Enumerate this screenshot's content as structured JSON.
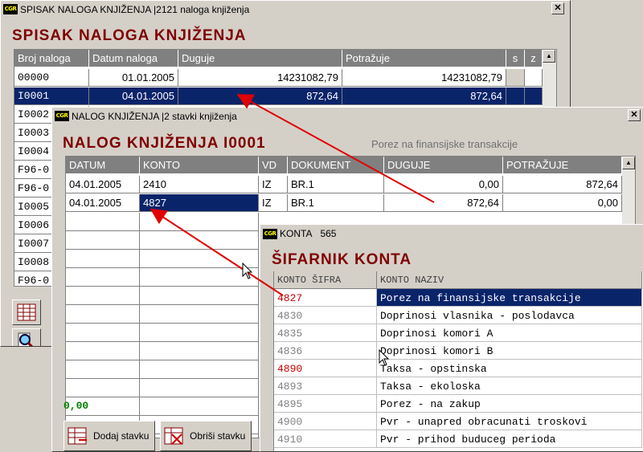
{
  "win1": {
    "title": "SPISAK NALOGA KNJIŽENJA |2121 naloga knjiženja",
    "heading": "SPISAK NALOGA KNJIŽENJA",
    "columns": [
      "Broj naloga",
      "Datum naloga",
      "Duguje",
      "Potražuje",
      "s",
      "z"
    ],
    "rows": [
      {
        "broj": "00000",
        "datum": "01.01.2005",
        "duguje": "14231082,79",
        "potrazuje": "14231082,79"
      },
      {
        "broj": "I0001",
        "datum": "04.01.2005",
        "duguje": "872,64",
        "potrazuje": "872,64"
      },
      {
        "broj": "I0002"
      },
      {
        "broj": "I0003"
      },
      {
        "broj": "I0004"
      },
      {
        "broj": "F96-0"
      },
      {
        "broj": "F96-0"
      },
      {
        "broj": "I0005"
      },
      {
        "broj": "I0006"
      },
      {
        "broj": "I0007"
      },
      {
        "broj": "I0008"
      },
      {
        "broj": "F96-0"
      }
    ]
  },
  "win2": {
    "title": "NALOG KNJIŽENJA |2 stavki knjiženja",
    "heading": "NALOG KNJIŽENJA I0001",
    "subtitle": "Porez na finansijske transakcije",
    "columns": [
      "DATUM",
      "KONTO",
      "VD",
      "DOKUMENT",
      "DUGUJE",
      "POTRAŽUJE"
    ],
    "rows": [
      {
        "datum": "04.01.2005",
        "konto": "2410",
        "vd": "IZ",
        "dokument": "BR.1",
        "duguje": "0,00",
        "potrazuje": "872,64"
      },
      {
        "datum": "04.01.2005",
        "konto": "4827",
        "vd": "IZ",
        "dokument": "BR.1",
        "duguje": "872,64",
        "potrazuje": "0,00"
      }
    ],
    "total": "0,00",
    "buttons": {
      "add": "Dodaj stavku",
      "delete": "Obriši stavku"
    }
  },
  "win3": {
    "title_prefix": "KONTA",
    "title_count": "565",
    "heading": "ŠIFARNIK KONTA",
    "columns": [
      "KONTO ŠIFRA",
      "KONTO NAZIV"
    ],
    "rows": [
      {
        "sifra": "4827",
        "naziv": "Porez na finansijske transakcije"
      },
      {
        "sifra": "4830",
        "naziv": "Doprinosi vlasnika - poslodavca"
      },
      {
        "sifra": "4835",
        "naziv": "Doprinosi komori A"
      },
      {
        "sifra": "4836",
        "naziv": "Doprinosi komori B"
      },
      {
        "sifra": "4890",
        "naziv": "Taksa - opstinska"
      },
      {
        "sifra": "4893",
        "naziv": "Taksa - ekoloska"
      },
      {
        "sifra": "4895",
        "naziv": "Porez - na zakup"
      },
      {
        "sifra": "4900",
        "naziv": "Pvr - unapred obracunati troskovi"
      },
      {
        "sifra": "4910",
        "naziv": "Pvr - prihod buduceg perioda"
      }
    ]
  },
  "colors": {
    "selection": "#0a246a",
    "heading": "#800000",
    "accent_red": "#c00000",
    "total_green": "#008000"
  }
}
